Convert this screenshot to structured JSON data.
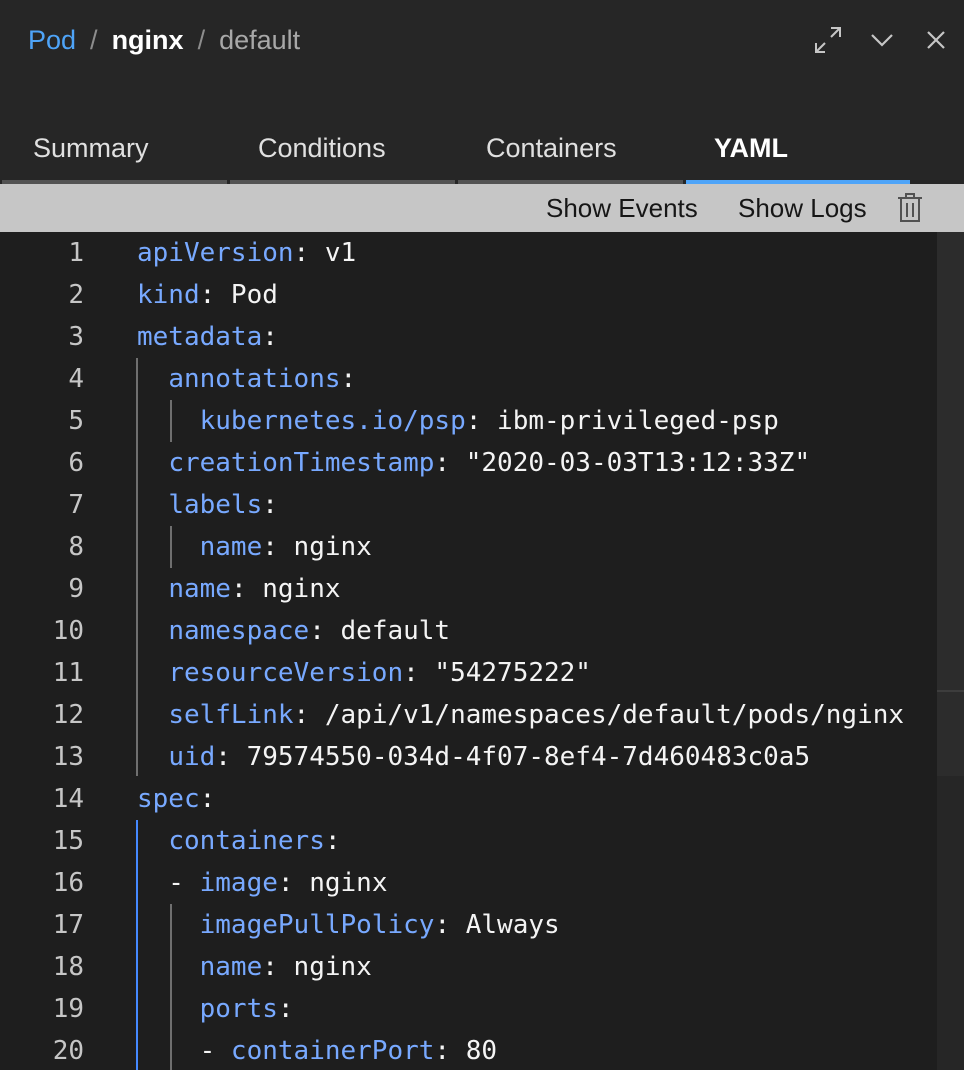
{
  "breadcrumb": {
    "kind": "Pod",
    "separator": "/",
    "name": "nginx",
    "namespace": "default"
  },
  "header_icons": [
    "expand-icon",
    "chevron-down-icon",
    "close-icon"
  ],
  "tabs": [
    {
      "label": "Summary",
      "active": false
    },
    {
      "label": "Conditions",
      "active": false
    },
    {
      "label": "Containers",
      "active": false
    },
    {
      "label": "YAML",
      "active": true
    }
  ],
  "toolbar": {
    "show_events": "Show Events",
    "show_logs": "Show Logs",
    "delete_icon": "trash-icon"
  },
  "colors": {
    "accent": "#4ea4f8",
    "yaml_key": "#78a9ff",
    "background": "#1e1e1e",
    "toolbar": "#c6c6c6"
  },
  "yaml_lines": [
    {
      "n": "1",
      "indent": "",
      "key": "apiVersion",
      "rest": ": v1"
    },
    {
      "n": "2",
      "indent": "",
      "key": "kind",
      "rest": ": Pod"
    },
    {
      "n": "3",
      "indent": "",
      "key": "metadata",
      "rest": ":"
    },
    {
      "n": "4",
      "indent": "  ",
      "key": "annotations",
      "rest": ":"
    },
    {
      "n": "5",
      "indent": "    ",
      "key": "kubernetes.io/psp",
      "rest": ": ibm-privileged-psp"
    },
    {
      "n": "6",
      "indent": "  ",
      "key": "creationTimestamp",
      "rest": ": \"2020-03-03T13:12:33Z\""
    },
    {
      "n": "7",
      "indent": "  ",
      "key": "labels",
      "rest": ":"
    },
    {
      "n": "8",
      "indent": "    ",
      "key": "name",
      "rest": ": nginx"
    },
    {
      "n": "9",
      "indent": "  ",
      "key": "name",
      "rest": ": nginx"
    },
    {
      "n": "10",
      "indent": "  ",
      "key": "namespace",
      "rest": ": default"
    },
    {
      "n": "11",
      "indent": "  ",
      "key": "resourceVersion",
      "rest": ": \"54275222\""
    },
    {
      "n": "12",
      "indent": "  ",
      "key": "selfLink",
      "rest": ": /api/v1/namespaces/default/pods/nginx"
    },
    {
      "n": "13",
      "indent": "  ",
      "key": "uid",
      "rest": ": 79574550-034d-4f07-8ef4-7d460483c0a5"
    },
    {
      "n": "14",
      "indent": "",
      "key": "spec",
      "rest": ":"
    },
    {
      "n": "15",
      "indent": "  ",
      "key": "containers",
      "rest": ":"
    },
    {
      "n": "16",
      "indent": "  - ",
      "key": "image",
      "rest": ": nginx"
    },
    {
      "n": "17",
      "indent": "    ",
      "key": "imagePullPolicy",
      "rest": ": Always"
    },
    {
      "n": "18",
      "indent": "    ",
      "key": "name",
      "rest": ": nginx"
    },
    {
      "n": "19",
      "indent": "    ",
      "key": "ports",
      "rest": ":"
    },
    {
      "n": "20",
      "indent": "    - ",
      "key": "containerPort",
      "rest": ": 80"
    }
  ]
}
